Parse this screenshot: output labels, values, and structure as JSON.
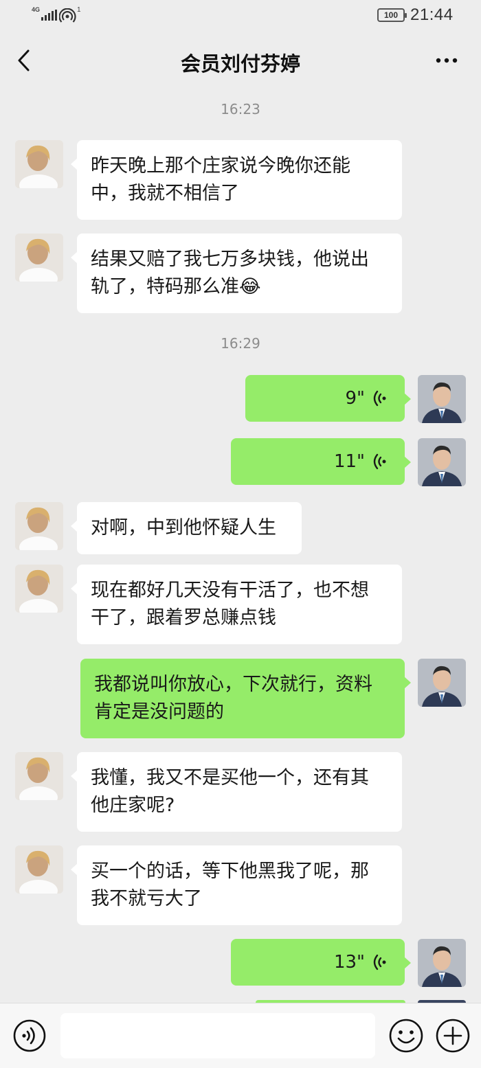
{
  "status_bar": {
    "network": "4G",
    "hotspot_count": "1",
    "battery": "100",
    "time": "21:44"
  },
  "header": {
    "title": "会员刘付芬婷"
  },
  "timestamps": [
    "16:23",
    "16:29"
  ],
  "messages": [
    {
      "side": "in",
      "text_lines": [
        "昨天晚上那个庄家说今晚你还能",
        "中，我就不相信了"
      ]
    },
    {
      "side": "in",
      "text_lines": [
        "结果又赔了我七万多块钱，他说出",
        "轨了，特码那么准"
      ],
      "emoji": "😂"
    },
    {
      "side": "out",
      "voice_duration": "9\""
    },
    {
      "side": "out",
      "voice_duration": "11\""
    },
    {
      "side": "in",
      "text_lines": [
        "对啊，中到他怀疑人生"
      ]
    },
    {
      "side": "in",
      "text_lines": [
        "现在都好几天没有干活了，也不想",
        "干了，跟着罗总赚点钱"
      ]
    },
    {
      "side": "out",
      "text_lines": [
        "我都说叫你放心，下次就行，资料",
        "肯定是没问题的"
      ]
    },
    {
      "side": "in",
      "text_lines": [
        "我懂，我又不是买他一个，还有其",
        "他庄家呢?"
      ]
    },
    {
      "side": "in",
      "text_lines": [
        "买一个的话，等下他黑我了呢，那",
        "我不就亏大了"
      ]
    },
    {
      "side": "out",
      "voice_duration": "13\""
    }
  ],
  "icons": {
    "back": "chevron-left-icon",
    "more": "more-dots-icon",
    "voice_toggle": "voice-icon",
    "emoji": "emoji-icon",
    "plus": "plus-icon"
  },
  "colors": {
    "background": "#ededed",
    "incoming_bubble": "#ffffff",
    "outgoing_bubble": "#95ec69"
  }
}
